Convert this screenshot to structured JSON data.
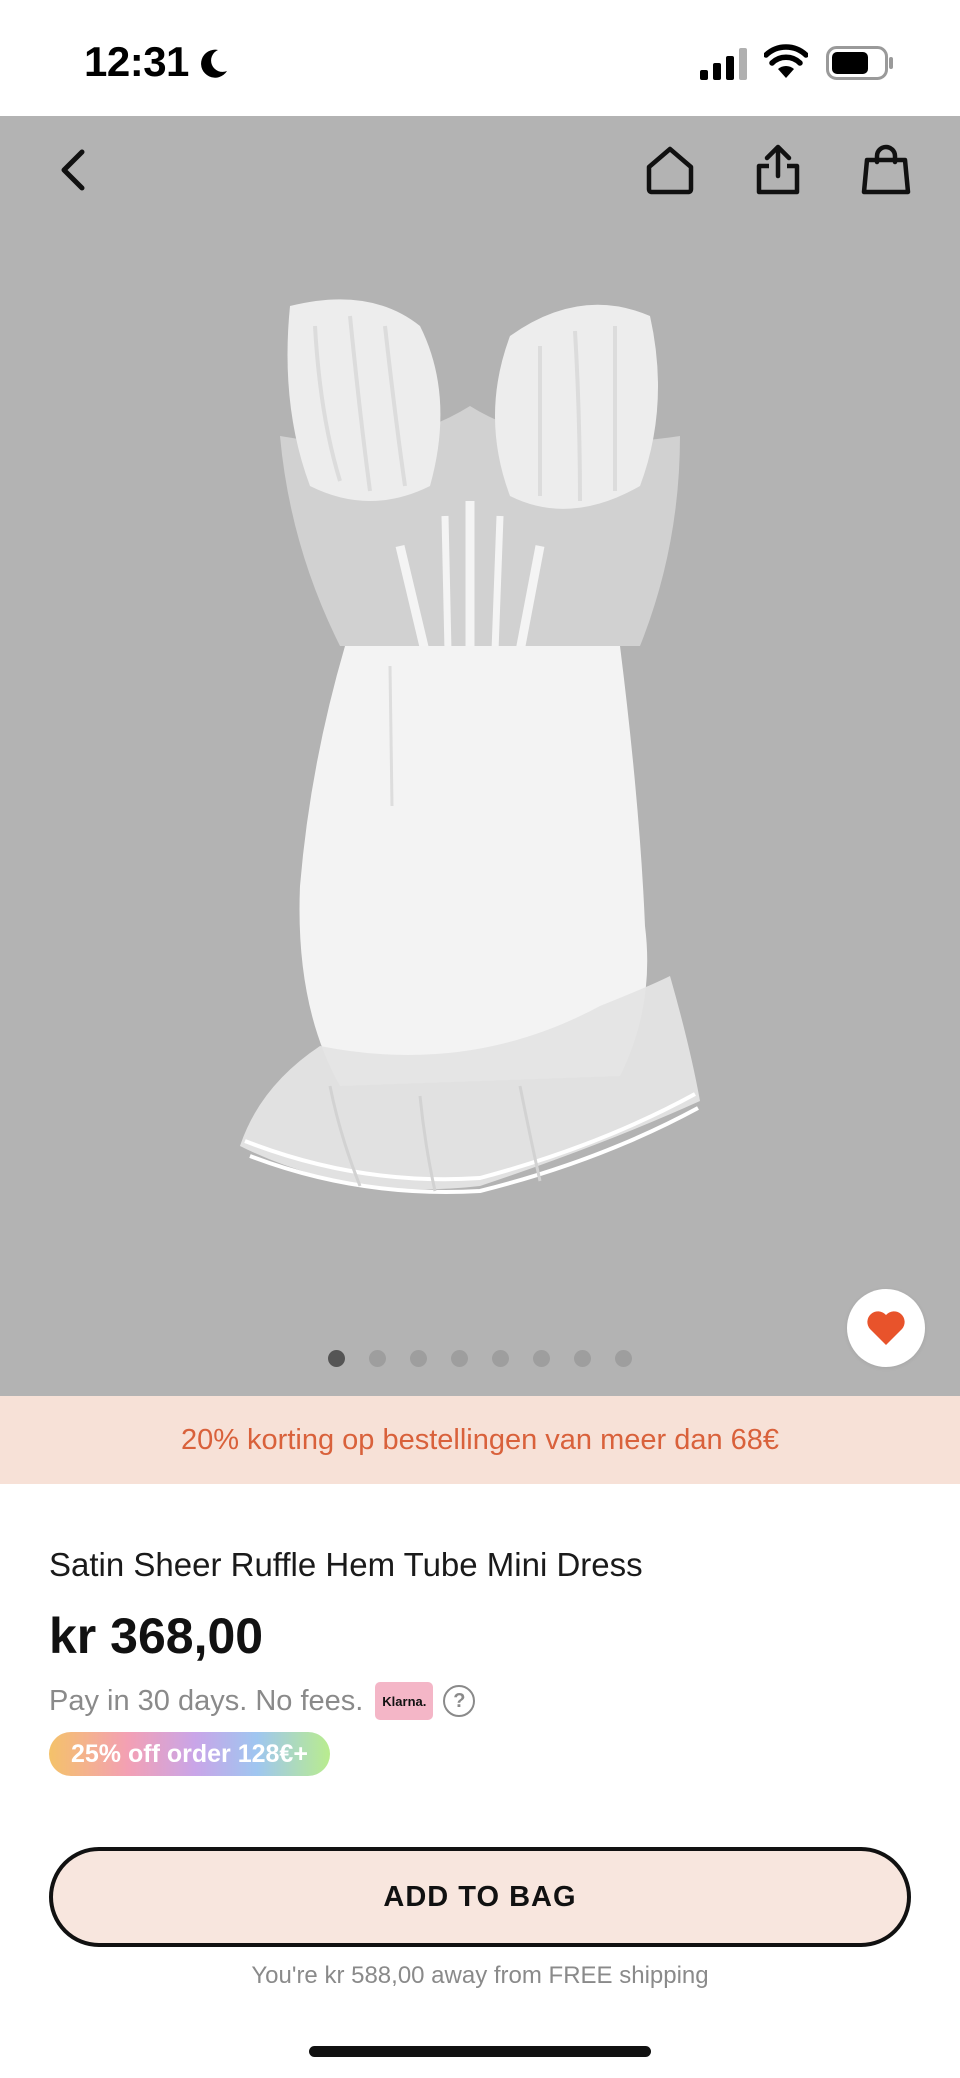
{
  "status_bar": {
    "time": "12:31",
    "icons": [
      "moon-icon",
      "signal-icon",
      "wifi-icon",
      "battery-icon"
    ]
  },
  "hero": {
    "icons": [
      "chevron-left-icon",
      "home-icon",
      "share-icon",
      "shopping-bag-icon",
      "heart-icon"
    ],
    "image_count": 8,
    "active_image": 1,
    "background_color": "#b3b3b3",
    "favorite_color": "#e8532b"
  },
  "promo": {
    "text": "20% korting op bestellingen van meer dan 68€",
    "color": "#d9613b",
    "background": "#f7e1d7"
  },
  "product": {
    "title": "Satin Sheer Ruffle Hem Tube Mini Dress",
    "price": "kr 368,00",
    "pay_later": "Pay in 30 days. No fees.",
    "klarna_label": "Klarna.",
    "help_glyph": "?",
    "discount_badge": "25% off order 128€+"
  },
  "cta": {
    "add_to_bag": "ADD TO BAG",
    "shipping_note": "You're kr 588,00 away from FREE shipping"
  }
}
